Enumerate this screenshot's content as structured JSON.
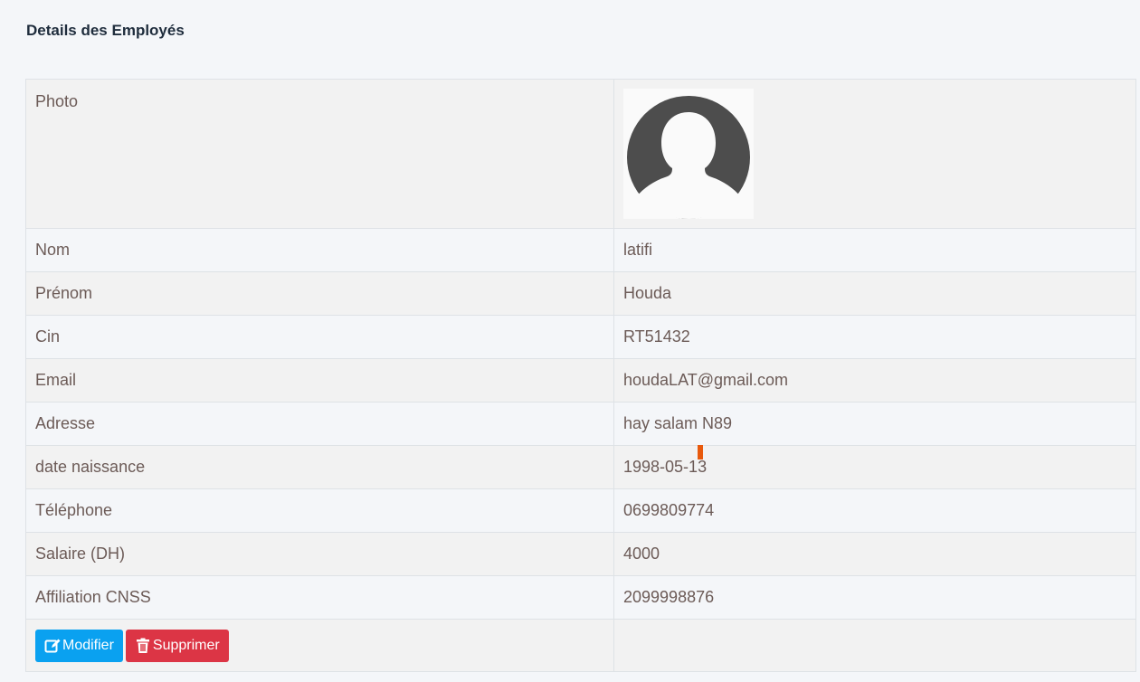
{
  "page": {
    "title": "Details des Employés"
  },
  "details": {
    "photo_label": "Photo",
    "rows": [
      {
        "label": "Nom",
        "value": "latifi"
      },
      {
        "label": "Prénom",
        "value": "Houda"
      },
      {
        "label": "Cin",
        "value": "RT51432"
      },
      {
        "label": "Email",
        "value": "houdaLAT@gmail.com"
      },
      {
        "label": "Adresse",
        "value": "hay salam N89"
      },
      {
        "label": "date naissance",
        "value": "1998-05-13"
      },
      {
        "label": "Téléphone",
        "value": "0699809774"
      },
      {
        "label": "Salaire (DH)",
        "value": "4000"
      },
      {
        "label": "Affiliation CNSS",
        "value": "2099998876"
      }
    ]
  },
  "actions": {
    "edit_label": "Modifier",
    "delete_label": "Supprimer"
  },
  "colors": {
    "edit": "#0aa1f0",
    "delete": "#dc3545",
    "avatar": "#4d4d4d"
  },
  "icons": {
    "avatar": "user-silhouette-icon",
    "edit": "edit-icon",
    "delete": "trash-icon"
  }
}
